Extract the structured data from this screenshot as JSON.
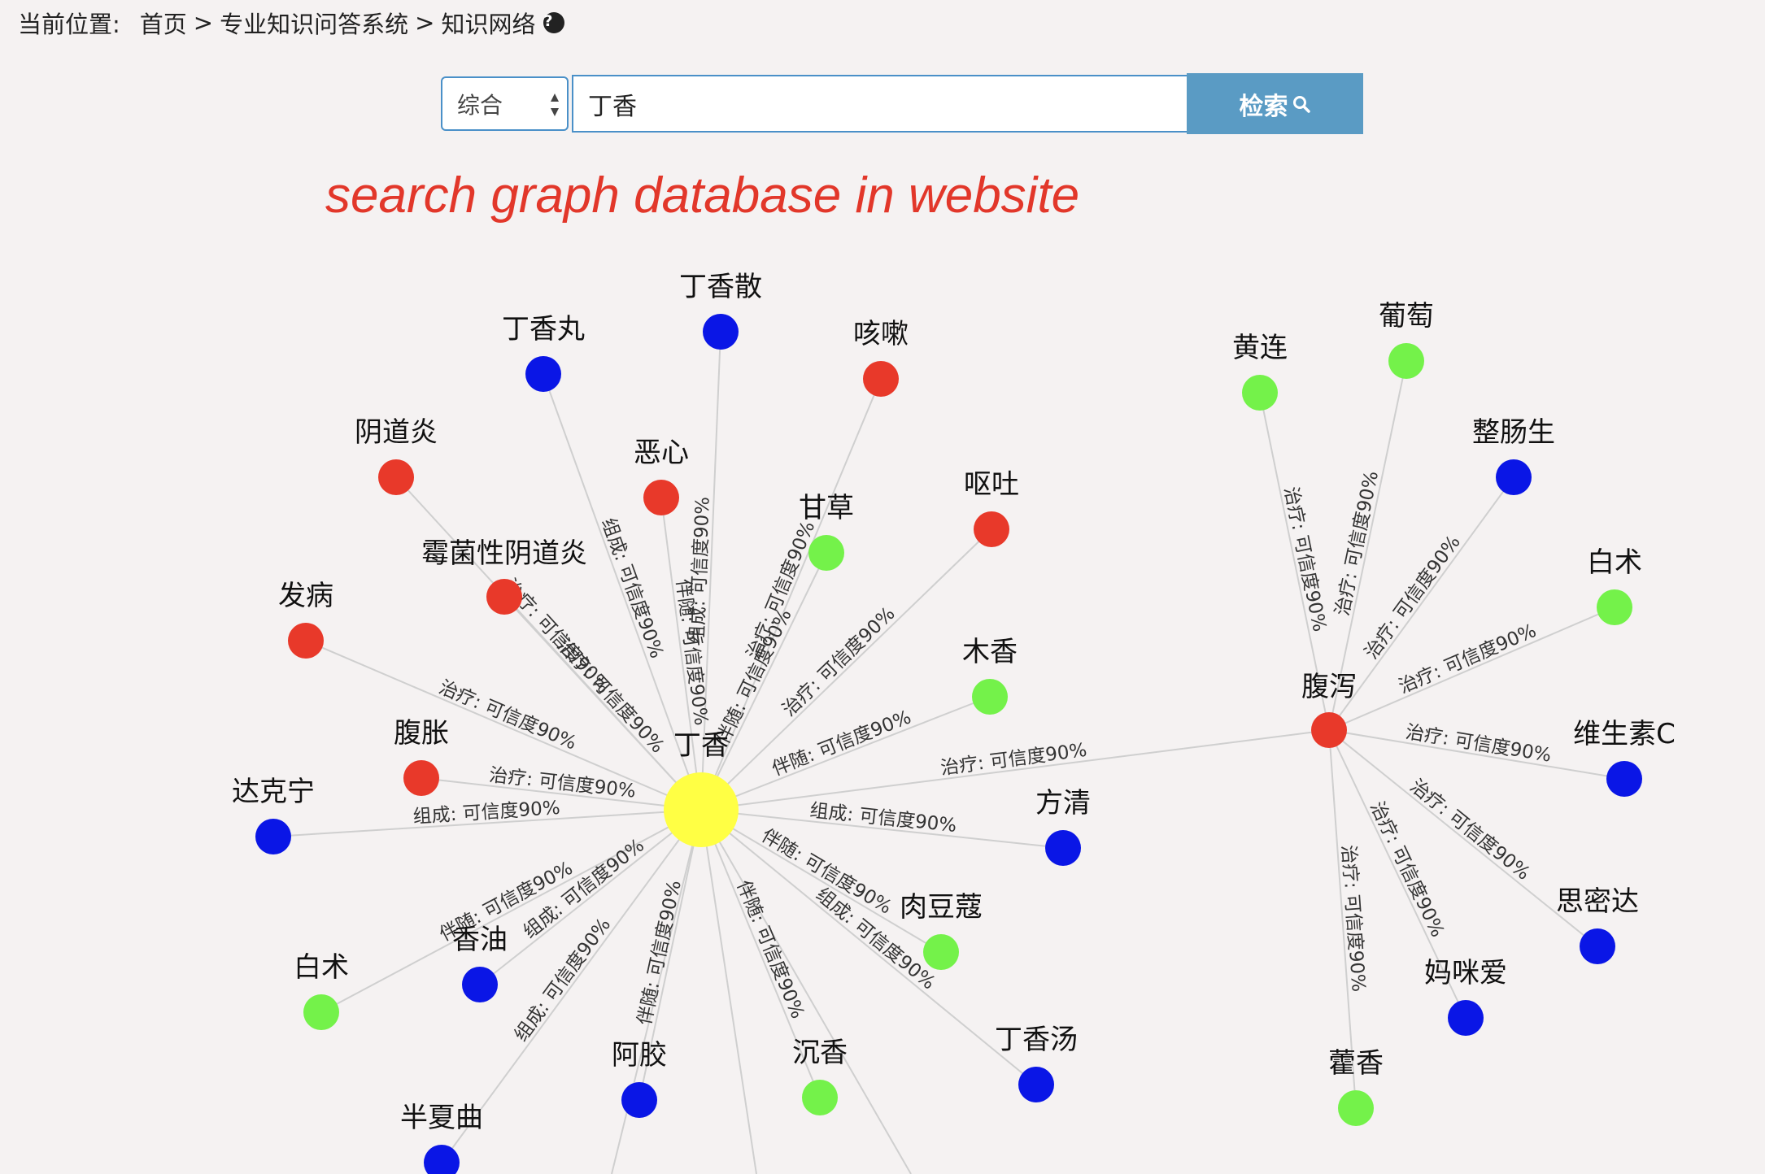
{
  "breadcrumb": {
    "prefix": "当前位置:",
    "items": [
      "首页",
      "专业知识问答系统",
      "知识网络"
    ],
    "separator": ">"
  },
  "search": {
    "type_value": "综合",
    "query": "丁香",
    "button_label": "检索"
  },
  "caption": "search graph database in website",
  "colors": {
    "center": "#ffff44",
    "red": "#e8392a",
    "blue": "#0a16e6",
    "green": "#74f24a",
    "button": "#5a9bc4",
    "caption": "#e2372a"
  },
  "graph": {
    "nodes": [
      {
        "id": "dingxiang",
        "label": "丁香",
        "color": "center",
        "center": true
      },
      {
        "id": "dingxiangsan",
        "label": "丁香散",
        "color": "blue"
      },
      {
        "id": "dingxiangwan",
        "label": "丁香丸",
        "color": "blue"
      },
      {
        "id": "kesou",
        "label": "咳嗽",
        "color": "red"
      },
      {
        "id": "yindaoyan",
        "label": "阴道炎",
        "color": "red"
      },
      {
        "id": "exin",
        "label": "恶心",
        "color": "red"
      },
      {
        "id": "gancao",
        "label": "甘草",
        "color": "green"
      },
      {
        "id": "outu",
        "label": "呕吐",
        "color": "red"
      },
      {
        "id": "meijun",
        "label": "霉菌性阴道炎",
        "color": "red"
      },
      {
        "id": "fabing",
        "label": "发病",
        "color": "red"
      },
      {
        "id": "muxiang",
        "label": "木香",
        "color": "green"
      },
      {
        "id": "fuzhang",
        "label": "腹胀",
        "color": "red"
      },
      {
        "id": "dakening",
        "label": "达克宁",
        "color": "blue"
      },
      {
        "id": "fangqing",
        "label": "方清",
        "color": "blue"
      },
      {
        "id": "xiangyou",
        "label": "香油",
        "color": "blue"
      },
      {
        "id": "baizhu1",
        "label": "白术",
        "color": "green"
      },
      {
        "id": "roudoukou",
        "label": "肉豆蔻",
        "color": "green"
      },
      {
        "id": "ejiao",
        "label": "阿胶",
        "color": "blue"
      },
      {
        "id": "chenxiang",
        "label": "沉香",
        "color": "green"
      },
      {
        "id": "dingxiangtang",
        "label": "丁香汤",
        "color": "blue"
      },
      {
        "id": "banxiaqu",
        "label": "半夏曲",
        "color": "blue"
      },
      {
        "id": "fuxie",
        "label": "腹泻",
        "color": "red"
      },
      {
        "id": "huanglian",
        "label": "黄连",
        "color": "green"
      },
      {
        "id": "putao",
        "label": "葡萄",
        "color": "green"
      },
      {
        "id": "zhengchangsheng",
        "label": "整肠生",
        "color": "blue"
      },
      {
        "id": "baizhu2",
        "label": "白术",
        "color": "green"
      },
      {
        "id": "weishengsuc",
        "label": "维生素C",
        "color": "blue"
      },
      {
        "id": "simida",
        "label": "思密达",
        "color": "blue"
      },
      {
        "id": "mamiai",
        "label": "妈咪爱",
        "color": "blue"
      },
      {
        "id": "huoxiang",
        "label": "藿香",
        "color": "green"
      }
    ],
    "edges": [
      {
        "source": "dingxiang",
        "target": "dingxiangsan",
        "label": "组成: 可信度90%"
      },
      {
        "source": "dingxiang",
        "target": "dingxiangwan",
        "label": "组成: 可信度90%"
      },
      {
        "source": "dingxiang",
        "target": "kesou",
        "label": "治疗: 可信度90%"
      },
      {
        "source": "dingxiang",
        "target": "yindaoyan",
        "label": "治疗: 可信度90%"
      },
      {
        "source": "dingxiang",
        "target": "exin",
        "label": "伴随: 可信度90%"
      },
      {
        "source": "dingxiang",
        "target": "gancao",
        "label": "伴随: 可信度90%"
      },
      {
        "source": "dingxiang",
        "target": "outu",
        "label": "治疗: 可信度90%"
      },
      {
        "source": "dingxiang",
        "target": "meijun",
        "label": "治疗: 可信度90%"
      },
      {
        "source": "dingxiang",
        "target": "fabing",
        "label": "治疗: 可信度90%"
      },
      {
        "source": "dingxiang",
        "target": "muxiang",
        "label": "伴随: 可信度90%"
      },
      {
        "source": "dingxiang",
        "target": "fuzhang",
        "label": "治疗: 可信度90%"
      },
      {
        "source": "dingxiang",
        "target": "dakening",
        "label": "组成: 可信度90%"
      },
      {
        "source": "dingxiang",
        "target": "fangqing",
        "label": "组成: 可信度90%"
      },
      {
        "source": "dingxiang",
        "target": "xiangyou",
        "label": "组成: 可信度90%"
      },
      {
        "source": "dingxiang",
        "target": "baizhu1",
        "label": "伴随: 可信度90%"
      },
      {
        "source": "dingxiang",
        "target": "roudoukou",
        "label": "伴随: 可信度90%"
      },
      {
        "source": "dingxiang",
        "target": "ejiao",
        "label": "伴随: 可信度90%"
      },
      {
        "source": "dingxiang",
        "target": "chenxiang",
        "label": "伴随: 可信度90%"
      },
      {
        "source": "dingxiang",
        "target": "dingxiangtang",
        "label": "组成: 可信度90%"
      },
      {
        "source": "dingxiang",
        "target": "banxiaqu",
        "label": "组成: 可信度90%"
      },
      {
        "source": "dingxiang",
        "target": "fuxie",
        "label": "治疗: 可信度90%"
      },
      {
        "source": "fuxie",
        "target": "huanglian",
        "label": "治疗: 可信度90%"
      },
      {
        "source": "fuxie",
        "target": "putao",
        "label": "治疗: 可信度90%"
      },
      {
        "source": "fuxie",
        "target": "zhengchangsheng",
        "label": "治疗: 可信度90%"
      },
      {
        "source": "fuxie",
        "target": "baizhu2",
        "label": "治疗: 可信度90%"
      },
      {
        "source": "fuxie",
        "target": "weishengsuc",
        "label": "治疗: 可信度90%"
      },
      {
        "source": "fuxie",
        "target": "simida",
        "label": "治疗: 可信度90%"
      },
      {
        "source": "fuxie",
        "target": "mamiai",
        "label": "治疗: 可信度90%"
      },
      {
        "source": "fuxie",
        "target": "huoxiang",
        "label": "治疗: 可信度90%"
      }
    ]
  }
}
